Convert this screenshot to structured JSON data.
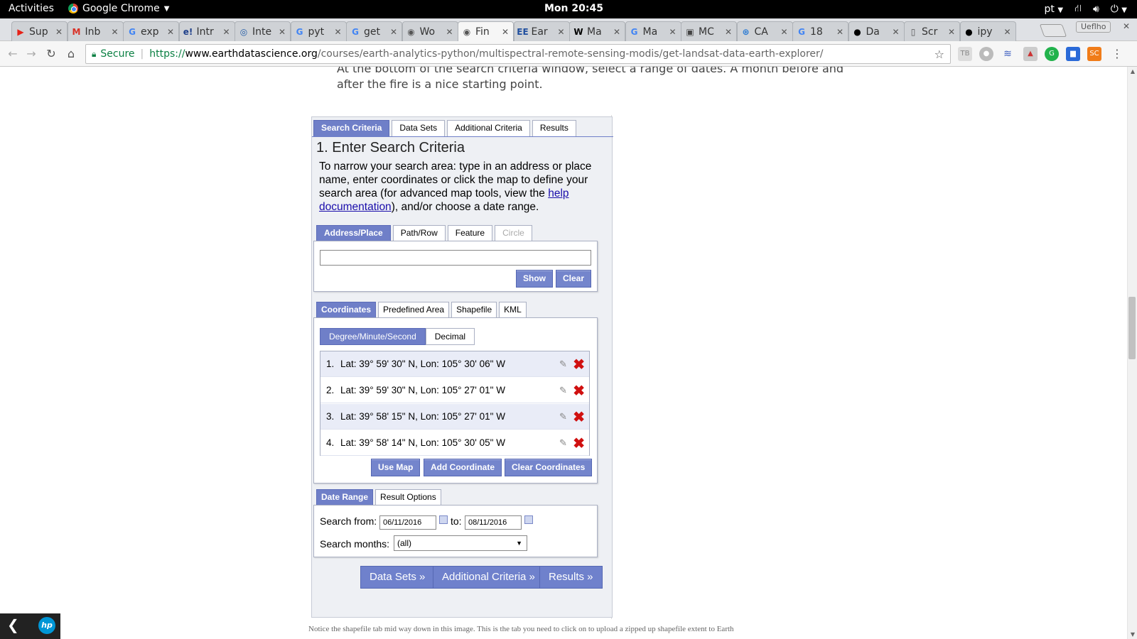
{
  "topbar": {
    "activities": "Activities",
    "app_name": "Google Chrome",
    "clock": "Mon 20:45",
    "language": "pt"
  },
  "tabs": [
    {
      "icon": "youtube-icon",
      "title": "Sup",
      "color": "#e62117",
      "glyph": "▶"
    },
    {
      "icon": "gmail-icon",
      "title": "Inb",
      "color": "#d93025",
      "glyph": "M"
    },
    {
      "icon": "google-icon",
      "title": "exp",
      "color": "#4285f4",
      "glyph": "G"
    },
    {
      "icon": "edx-icon",
      "title": "Intr",
      "color": "#1e3f8a",
      "glyph": "e!"
    },
    {
      "icon": "globe-icon",
      "title": "Inte",
      "color": "#1f5aa6",
      "glyph": "◎"
    },
    {
      "icon": "google-icon",
      "title": "pyt",
      "color": "#4285f4",
      "glyph": "G"
    },
    {
      "icon": "google-icon",
      "title": "get",
      "color": "#4285f4",
      "glyph": "G"
    },
    {
      "icon": "globe-icon",
      "title": "Wo",
      "color": "#555555",
      "glyph": "◉"
    },
    {
      "icon": "globe-icon",
      "title": "Fin",
      "color": "#555555",
      "glyph": "◉"
    },
    {
      "icon": "ee-icon",
      "title": "Ear",
      "color": "#1f4e9e",
      "glyph": "EE"
    },
    {
      "icon": "wikipedia-icon",
      "title": "Ma",
      "color": "#000000",
      "glyph": "W"
    },
    {
      "icon": "google-icon",
      "title": "Ma",
      "color": "#4285f4",
      "glyph": "G"
    },
    {
      "icon": "site-icon",
      "title": "MC",
      "color": "#444444",
      "glyph": "▣"
    },
    {
      "icon": "globe-icon",
      "title": "CA",
      "color": "#2b7bd4",
      "glyph": "⊛"
    },
    {
      "icon": "google-icon",
      "title": "18",
      "color": "#4285f4",
      "glyph": "G"
    },
    {
      "icon": "github-icon",
      "title": "Da",
      "color": "#000000",
      "glyph": "●"
    },
    {
      "icon": "page-icon",
      "title": "Scr",
      "color": "#555555",
      "glyph": "▯"
    },
    {
      "icon": "github-icon",
      "title": "ipy",
      "color": "#000000",
      "glyph": "●"
    }
  ],
  "profile_label": "Ueflho",
  "address": {
    "secure": "Secure",
    "scheme": "https://",
    "host": "www.earthdatascience.org",
    "path": "/courses/earth-analytics-python/multispectral-remote-sensing-modis/get-landsat-data-earth-explorer/"
  },
  "page": {
    "intro_cut": "At the bottom of the search criteria window, select a range of dates. A month before and after the fire is a nice starting point.",
    "bottom_cut": "Notice the shapefile tab mid way down in this image. This is the tab you need to click on to upload a zipped up shapefile extent to Earth"
  },
  "ee": {
    "main_tabs": [
      "Search Criteria",
      "Data Sets",
      "Additional Criteria",
      "Results"
    ],
    "heading": "1. Enter Search Criteria",
    "intro_before": "To narrow your search area: type in an address or place name, enter coordinates or click the map to define your search area (for advanced map tools, view the ",
    "intro_link": "help documentation",
    "intro_after": "), and/or choose a date range.",
    "area_tabs": [
      "Address/Place",
      "Path/Row",
      "Feature",
      "Circle"
    ],
    "address_value": "",
    "show_btn": "Show",
    "clear_btn": "Clear",
    "coord_tabs": [
      "Coordinates",
      "Predefined Area",
      "Shapefile",
      "KML"
    ],
    "format_tabs": [
      "Degree/Minute/Second",
      "Decimal"
    ],
    "coordinates": [
      {
        "num": "1.",
        "text": "Lat: 39° 59' 30\" N, Lon: 105° 30' 06\" W"
      },
      {
        "num": "2.",
        "text": "Lat: 39° 59' 30\" N, Lon: 105° 27' 01\" W"
      },
      {
        "num": "3.",
        "text": "Lat: 39° 58' 15\" N, Lon: 105° 27' 01\" W"
      },
      {
        "num": "4.",
        "text": "Lat: 39° 58' 14\" N, Lon: 105° 30' 05\" W"
      }
    ],
    "use_map_btn": "Use Map",
    "add_coord_btn": "Add Coordinate",
    "clear_coords_btn": "Clear Coordinates",
    "date_tabs": [
      "Date Range",
      "Result Options"
    ],
    "search_from_label": "Search from:",
    "from_value": "06/11/2016",
    "to_label": "to:",
    "to_value": "08/11/2016",
    "months_label": "Search months:",
    "months_value": "(all)",
    "nav_buttons": [
      "Data Sets »",
      "Additional Criteria »",
      "Results »"
    ]
  }
}
